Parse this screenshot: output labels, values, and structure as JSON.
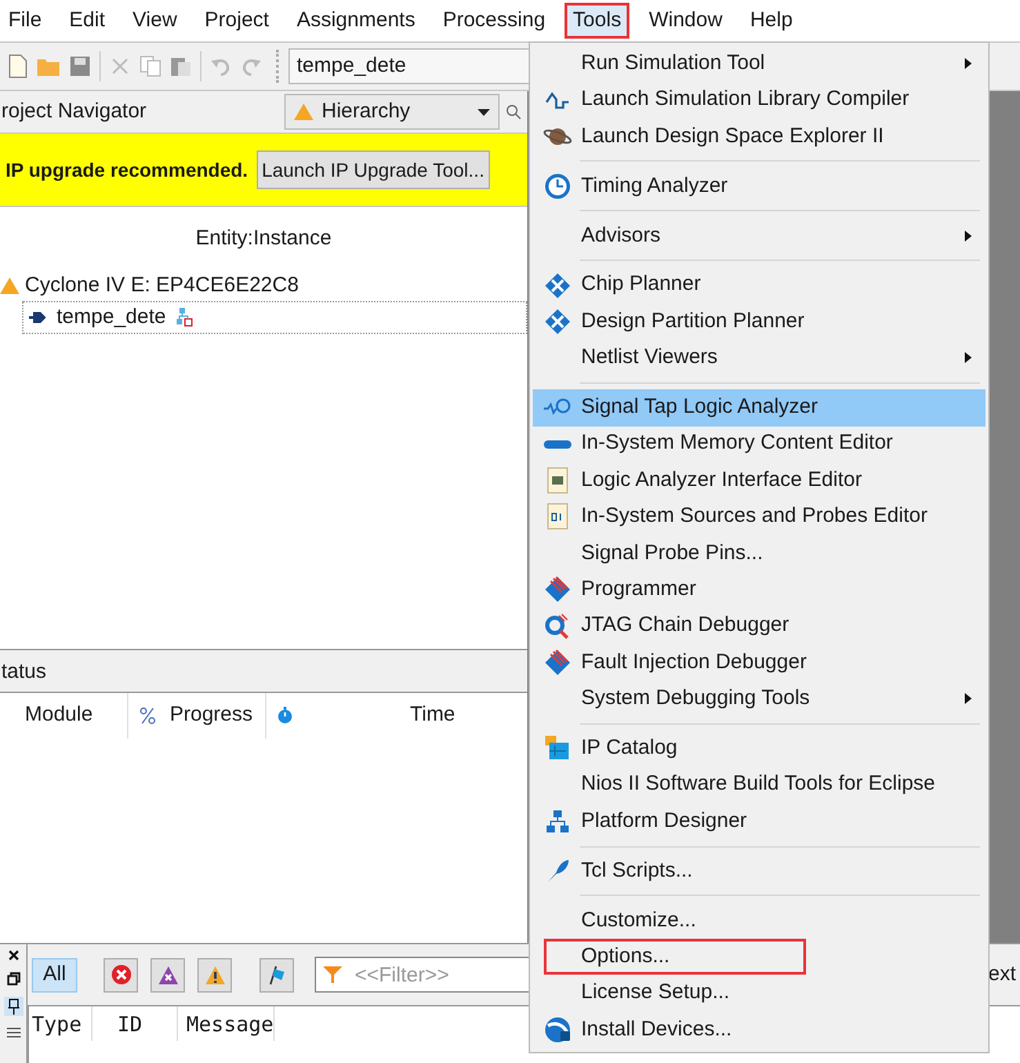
{
  "menu_bar": [
    {
      "label": "File",
      "selected": false,
      "outlined": false
    },
    {
      "label": "Edit",
      "selected": false,
      "outlined": false
    },
    {
      "label": "View",
      "selected": false,
      "outlined": false
    },
    {
      "label": "Project",
      "selected": false,
      "outlined": false
    },
    {
      "label": "Assignments",
      "selected": false,
      "outlined": false
    },
    {
      "label": "Processing",
      "selected": false,
      "outlined": false
    },
    {
      "label": "Tools",
      "selected": true,
      "outlined": true
    },
    {
      "label": "Window",
      "selected": false,
      "outlined": false
    },
    {
      "label": "Help",
      "selected": false,
      "outlined": false
    }
  ],
  "toolbar": {
    "project_field": "tempe_dete"
  },
  "project_navigator": {
    "title": "roject Navigator",
    "view_dropdown": "Hierarchy",
    "notice": {
      "message": "IP upgrade recommended.",
      "button": "Launch IP Upgrade Tool..."
    },
    "column_header": "Entity:Instance",
    "tree": [
      {
        "label": "Cyclone IV E: EP4CE6E22C8",
        "children": [
          {
            "label": "tempe_dete"
          }
        ]
      }
    ]
  },
  "status_pane": {
    "title": "tatus",
    "columns": [
      "Module",
      "Progress",
      "Time"
    ]
  },
  "messages_pane": {
    "filter_buttons": [
      {
        "kind": "all",
        "label": "All",
        "selected": true
      },
      {
        "kind": "error",
        "selected": false
      },
      {
        "kind": "critical",
        "selected": false
      },
      {
        "kind": "warning",
        "selected": false
      },
      {
        "kind": "flag",
        "selected": false
      }
    ],
    "filter_placeholder": "<<Filter>>",
    "side_button": "ext",
    "columns": [
      "Type",
      "ID",
      "Message"
    ]
  },
  "tools_menu": [
    {
      "kind": "item",
      "label": "Run Simulation Tool",
      "submenu": true,
      "selected": false,
      "outlined": false
    },
    {
      "kind": "item",
      "label": "Launch Simulation Library Compiler",
      "submenu": false,
      "selected": false,
      "outlined": false
    },
    {
      "kind": "item",
      "label": "Launch Design Space Explorer II",
      "submenu": false,
      "selected": false,
      "outlined": false
    },
    {
      "kind": "separator"
    },
    {
      "kind": "item",
      "label": "Timing Analyzer",
      "submenu": false,
      "selected": false,
      "outlined": false
    },
    {
      "kind": "separator"
    },
    {
      "kind": "item",
      "label": "Advisors",
      "submenu": true,
      "selected": false,
      "outlined": false
    },
    {
      "kind": "separator"
    },
    {
      "kind": "item",
      "label": "Chip Planner",
      "submenu": false,
      "selected": false,
      "outlined": false
    },
    {
      "kind": "item",
      "label": "Design Partition Planner",
      "submenu": false,
      "selected": false,
      "outlined": false
    },
    {
      "kind": "item",
      "label": "Netlist Viewers",
      "submenu": true,
      "selected": false,
      "outlined": false
    },
    {
      "kind": "separator"
    },
    {
      "kind": "item",
      "label": "Signal Tap Logic Analyzer",
      "submenu": false,
      "selected": true,
      "outlined": false
    },
    {
      "kind": "item",
      "label": "In-System Memory Content Editor",
      "submenu": false,
      "selected": false,
      "outlined": false
    },
    {
      "kind": "item",
      "label": "Logic Analyzer Interface Editor",
      "submenu": false,
      "selected": false,
      "outlined": false
    },
    {
      "kind": "item",
      "label": "In-System Sources and Probes Editor",
      "submenu": false,
      "selected": false,
      "outlined": false
    },
    {
      "kind": "item",
      "label": "Signal Probe Pins...",
      "submenu": false,
      "selected": false,
      "outlined": false
    },
    {
      "kind": "item",
      "label": "Programmer",
      "submenu": false,
      "selected": false,
      "outlined": false
    },
    {
      "kind": "item",
      "label": "JTAG Chain Debugger",
      "submenu": false,
      "selected": false,
      "outlined": false
    },
    {
      "kind": "item",
      "label": "Fault Injection Debugger",
      "submenu": false,
      "selected": false,
      "outlined": false
    },
    {
      "kind": "item",
      "label": "System Debugging Tools",
      "submenu": true,
      "selected": false,
      "outlined": false
    },
    {
      "kind": "separator"
    },
    {
      "kind": "item",
      "label": "IP Catalog",
      "submenu": false,
      "selected": false,
      "outlined": false
    },
    {
      "kind": "item",
      "label": "Nios II Software Build Tools for Eclipse",
      "submenu": false,
      "selected": false,
      "outlined": false
    },
    {
      "kind": "item",
      "label": "Platform Designer",
      "submenu": false,
      "selected": false,
      "outlined": false
    },
    {
      "kind": "separator"
    },
    {
      "kind": "item",
      "label": "Tcl Scripts...",
      "submenu": false,
      "selected": false,
      "outlined": false
    },
    {
      "kind": "separator"
    },
    {
      "kind": "item",
      "label": "Customize...",
      "submenu": false,
      "selected": false,
      "outlined": false
    },
    {
      "kind": "item",
      "label": "Options...",
      "submenu": false,
      "selected": false,
      "outlined": true
    },
    {
      "kind": "item",
      "label": "License Setup...",
      "submenu": false,
      "selected": false,
      "outlined": false
    },
    {
      "kind": "item",
      "label": "Install Devices...",
      "submenu": false,
      "selected": false,
      "outlined": false
    }
  ]
}
